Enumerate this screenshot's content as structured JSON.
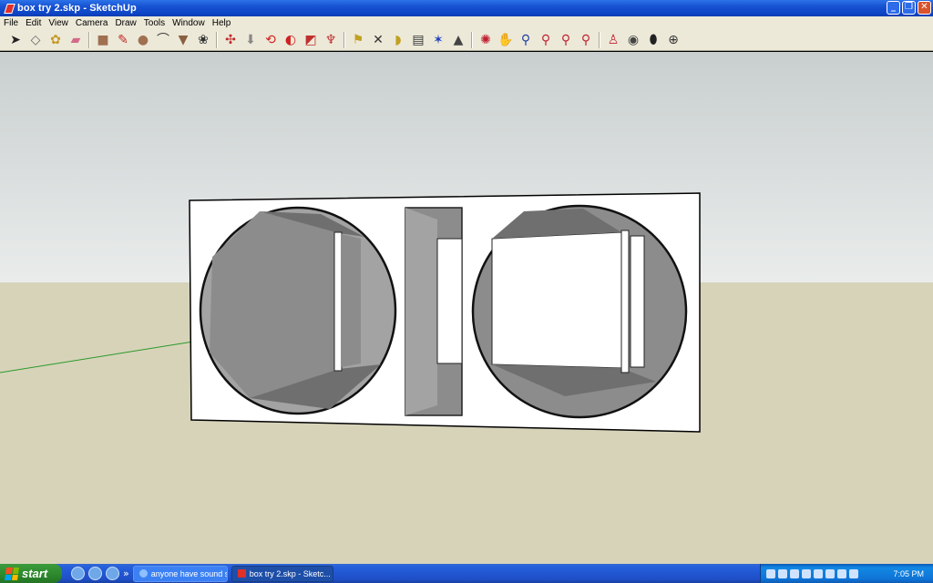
{
  "window": {
    "title": "box try 2.skp - SketchUp",
    "min_label": "_",
    "max_label": "❐",
    "close_label": "✕"
  },
  "menu": [
    "File",
    "Edit",
    "View",
    "Camera",
    "Draw",
    "Tools",
    "Window",
    "Help"
  ],
  "toolbar": [
    {
      "name": "select-tool",
      "glyph": "➤",
      "color": "#222222"
    },
    {
      "name": "make-component-tool",
      "glyph": "◇",
      "color": "#666666"
    },
    {
      "name": "paint-bucket-tool",
      "glyph": "✿",
      "color": "#c49a2a"
    },
    {
      "name": "eraser-tool",
      "glyph": "▰",
      "color": "#d46a8a"
    },
    {
      "sep": true
    },
    {
      "name": "rectangle-tool",
      "glyph": "■",
      "color": "#a07050"
    },
    {
      "name": "line-tool",
      "glyph": "✎",
      "color": "#c0282a"
    },
    {
      "name": "circle-tool",
      "glyph": "●",
      "color": "#a07050"
    },
    {
      "name": "arc-tool",
      "glyph": "⌒",
      "color": "#333333"
    },
    {
      "name": "polygon-tool",
      "glyph": "▼",
      "color": "#8a6040"
    },
    {
      "name": "freehand-tool",
      "glyph": "❀",
      "color": "#333333"
    },
    {
      "sep": true
    },
    {
      "name": "move-tool",
      "glyph": "✣",
      "color": "#c0282a"
    },
    {
      "name": "push-pull-tool",
      "glyph": "⬇",
      "color": "#888888"
    },
    {
      "name": "rotate-tool",
      "glyph": "⟲",
      "color": "#d02020"
    },
    {
      "name": "follow-me-tool",
      "glyph": "◐",
      "color": "#d02020"
    },
    {
      "name": "scale-tool",
      "glyph": "◩",
      "color": "#c03030"
    },
    {
      "name": "offset-tool",
      "glyph": "♆",
      "color": "#c03030"
    },
    {
      "sep": true
    },
    {
      "name": "tape-measure-tool",
      "glyph": "⚑",
      "color": "#c0a020"
    },
    {
      "name": "dimension-tool",
      "glyph": "✕",
      "color": "#333333"
    },
    {
      "name": "protractor-tool",
      "glyph": "◗",
      "color": "#c0a020"
    },
    {
      "name": "text-tool",
      "glyph": "▤",
      "color": "#333333"
    },
    {
      "name": "axes-tool",
      "glyph": "✶",
      "color": "#2040c0"
    },
    {
      "name": "3d-text-tool",
      "glyph": "▲",
      "color": "#444444"
    },
    {
      "sep": true
    },
    {
      "name": "orbit-tool",
      "glyph": "✺",
      "color": "#c02030"
    },
    {
      "name": "pan-tool",
      "glyph": "✋",
      "color": "#555555"
    },
    {
      "name": "zoom-tool",
      "glyph": "⚲",
      "color": "#2040a0"
    },
    {
      "name": "zoom-window-tool",
      "glyph": "⚲",
      "color": "#c02030"
    },
    {
      "name": "zoom-extents-tool",
      "glyph": "⚲",
      "color": "#c02030"
    },
    {
      "name": "previous-view-tool",
      "glyph": "⚲",
      "color": "#c02030"
    },
    {
      "sep": true
    },
    {
      "name": "position-camera-tool",
      "glyph": "♙",
      "color": "#c02030"
    },
    {
      "name": "look-around-tool",
      "glyph": "◉",
      "color": "#444444"
    },
    {
      "name": "walk-tool",
      "glyph": "⬮",
      "color": "#222222"
    },
    {
      "name": "section-plane-tool",
      "glyph": "⊕",
      "color": "#333333"
    }
  ],
  "scene": {
    "sky_top": "#c9cfcf",
    "sky_bottom": "#e9eceb",
    "ground": "#d7d3b9",
    "box_face": "#ffffff",
    "cavity_dark": "#6f6f6f",
    "cavity_mid": "#8c8c8c",
    "cavity_light": "#a3a3a3"
  },
  "taskbar": {
    "start_label": "start",
    "quicklaunch_more": "»",
    "tasks": [
      {
        "label": "anyone have sound s...",
        "active": false
      },
      {
        "label": "box try 2.skp - Sketc...",
        "active": true
      }
    ],
    "clock": "7:05 PM"
  }
}
